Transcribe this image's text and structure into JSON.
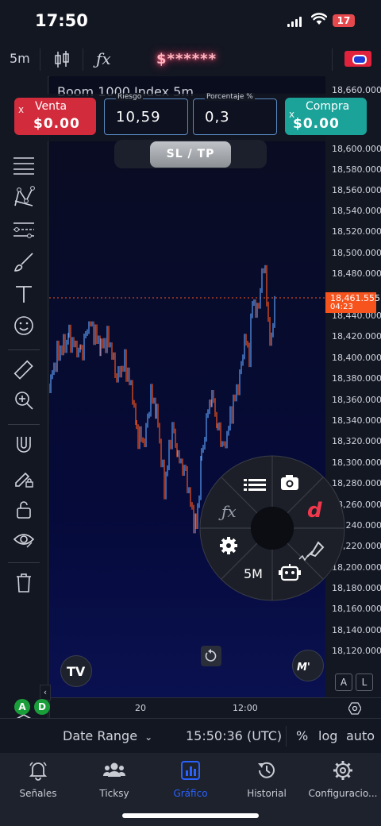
{
  "status_bar": {
    "time": "17:50",
    "battery": "17"
  },
  "toolbar": {
    "interval": "5m",
    "indicators_icon": "fx-icon",
    "balance": "$******"
  },
  "chart": {
    "title_partial": "Boom 1000 Index 5m",
    "y_ticks": [
      "18,660.000",
      "18,600.000",
      "18,580.000",
      "18,560.000",
      "18,540.000",
      "18,520.000",
      "18,500.000",
      "18,480.000",
      "18,440.000",
      "18,420.000",
      "18,400.000",
      "18,380.000",
      "18,360.000",
      "18,340.000",
      "18,320.000",
      "18,300.000",
      "18,280.000",
      "18,260.000",
      "18,240.000",
      "18,220.000",
      "18,200.000",
      "18,180.000",
      "18,160.000",
      "18,140.000",
      "18,120.000"
    ],
    "current_price": "18,461.555",
    "countdown": "04:23",
    "x_ticks": [
      "20",
      "12:00"
    ],
    "colors": {
      "up": "#5b9cf6",
      "down": "#f7531d",
      "price_line": "#f7531d"
    }
  },
  "order_panel": {
    "sell": {
      "label": "Venta",
      "value": "$0.00",
      "icon": "x"
    },
    "risk": {
      "label": "Riesgo",
      "value": "10,59"
    },
    "percent": {
      "label": "Porcentaje %",
      "value": "0,3"
    },
    "buy": {
      "label": "Compra",
      "value": "$0.00",
      "icon": "x"
    },
    "sltp_label": "SL / TP"
  },
  "radial_menu": {
    "interval_label": "5M"
  },
  "corner_buttons": {
    "auto_scale": "A",
    "log_scale": "L"
  },
  "badges": {
    "a": "A",
    "d": "D"
  },
  "bottom_bar": {
    "date_range": "Date Range",
    "time": "15:50:36 (UTC)",
    "percent": "%",
    "log": "log",
    "auto": "auto"
  },
  "tabs": [
    {
      "label": "Señales",
      "icon": "bell-icon"
    },
    {
      "label": "Ticksy",
      "icon": "users-icon"
    },
    {
      "label": "Gráfico",
      "icon": "chart-icon",
      "active": true
    },
    {
      "label": "Historial",
      "icon": "history-icon"
    },
    {
      "label": "Configuracio...",
      "icon": "gear-icon"
    }
  ]
}
